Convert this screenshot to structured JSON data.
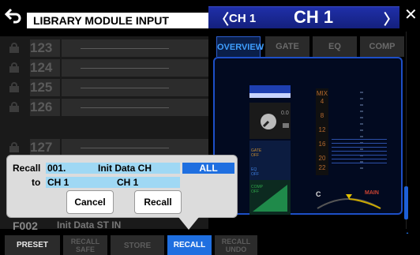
{
  "header": {
    "title": "LIBRARY MODULE INPUT",
    "ch_small": "CH 1",
    "ch_big": "CH 1"
  },
  "library": {
    "rows": [
      {
        "number": "123"
      },
      {
        "number": "124"
      },
      {
        "number": "125"
      },
      {
        "number": "126"
      },
      {
        "number": "127"
      }
    ],
    "partial_row": {
      "number": "F002",
      "name": "Init Data ST IN"
    }
  },
  "tabs": [
    "OVERVIEW",
    "GATE",
    "EQ",
    "COMP"
  ],
  "strip": {
    "gain_value": "0.0",
    "gate_label": "GATE OFF",
    "eq_label": "EQ OFF",
    "comp_label": "COMP OFF",
    "pan_c": "C",
    "pan_main": "MAIN"
  },
  "meter_labels": [
    "MIX",
    "4",
    "8",
    "12",
    "16",
    "20",
    "22"
  ],
  "popup": {
    "recall_label": "Recall",
    "recall_number": "001.",
    "recall_name": "Init Data CH",
    "all_label": "ALL",
    "to_label": "to",
    "to_from": "CH 1",
    "to_to": "CH 1",
    "cancel_label": "Cancel",
    "recall_button_label": "Recall"
  },
  "bottom": {
    "preset": "PRESET",
    "recall_safe_1": "RECALL",
    "recall_safe_2": "SAFE",
    "store": "STORE",
    "recall": "RECALL",
    "recall_undo_1": "RECALL",
    "recall_undo_2": "UNDO"
  },
  "colors": {
    "accent_blue": "#1f6fe0",
    "panel_border": "#1d4fc7",
    "field_blue": "#9fd8f4"
  }
}
